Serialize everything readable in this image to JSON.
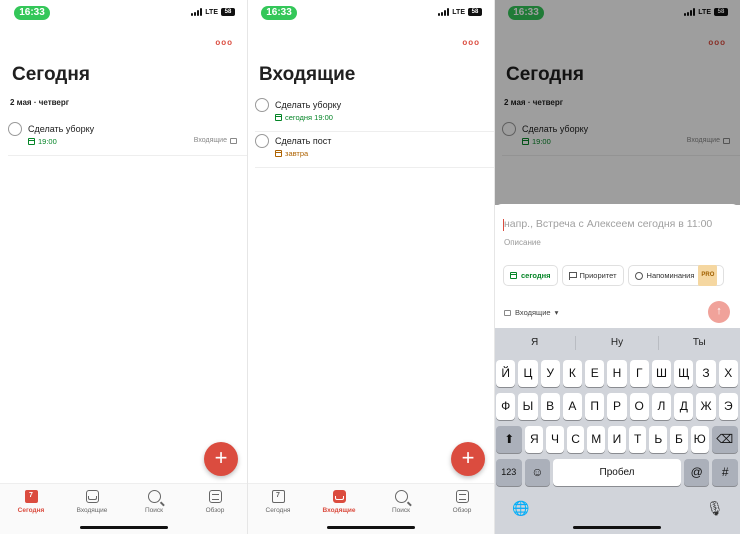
{
  "status": {
    "time": "16:33",
    "network": "LTE",
    "battery": "58"
  },
  "screen1": {
    "title": "Сегодня",
    "date": "2 мая · четверг",
    "tasks": [
      {
        "name": "Сделать уборку",
        "due": "19:00",
        "project": "Входящие"
      }
    ]
  },
  "screen2": {
    "title": "Входящие",
    "tasks": [
      {
        "name": "Сделать уборку",
        "due": "сегодня 19:00"
      },
      {
        "name": "Сделать пост",
        "due": "завтра"
      }
    ]
  },
  "more_icon": "ооо",
  "fab_label": "+",
  "tabs": [
    {
      "label": "Сегодня",
      "icon": "today-icon",
      "glyph": "7"
    },
    {
      "label": "Входящие",
      "icon": "inbox-icon"
    },
    {
      "label": "Поиск",
      "icon": "search-icon"
    },
    {
      "label": "Обзор",
      "icon": "browse-icon"
    }
  ],
  "quick_add": {
    "placeholder": "напр., Встреча с Алексеем сегодня в 11:00",
    "description": "Описание",
    "chips": {
      "date": "сегодня",
      "priority": "Приоритет",
      "reminders": "Напоминания",
      "pro": "PRO"
    },
    "project": "Входящие",
    "send": "↑"
  },
  "keyboard": {
    "suggestions": [
      "Я",
      "Ну",
      "Ты"
    ],
    "row1": [
      "Й",
      "Ц",
      "У",
      "К",
      "Е",
      "Н",
      "Г",
      "Ш",
      "Щ",
      "З",
      "Х"
    ],
    "row2": [
      "Ф",
      "Ы",
      "В",
      "А",
      "П",
      "Р",
      "О",
      "Л",
      "Д",
      "Ж",
      "Э"
    ],
    "row3": [
      "Я",
      "Ч",
      "С",
      "М",
      "И",
      "Т",
      "Ь",
      "Б",
      "Ю"
    ],
    "num": "123",
    "space": "Пробел",
    "at": "@",
    "hash": "#"
  },
  "colors": {
    "accent": "#db4c3f",
    "green": "#058527",
    "orange": "#ad6200"
  }
}
